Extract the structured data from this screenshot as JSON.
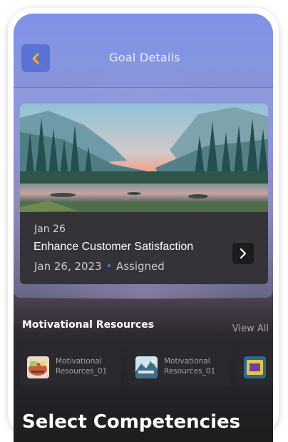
{
  "header": {
    "title": "Goal Details"
  },
  "goal": {
    "date_short": "Jan 26",
    "title": "Enhance Customer Satisfaction",
    "date_full": "Jan 26, 2023",
    "status": "Assigned"
  },
  "resources": {
    "heading": "Motivational Resources",
    "view_all": "View All",
    "items": [
      {
        "line1": "Motivational",
        "line2": "Resources_01"
      },
      {
        "line1": "Motivational",
        "line2": "Resources_01"
      }
    ]
  },
  "competencies": {
    "heading": "Select Competencies"
  },
  "colors": {
    "accent": "#5b73d6",
    "back_arrow": "#f2b13a",
    "status_dot": "#5a6fe0"
  },
  "icons": {
    "back": "chevron-left-icon",
    "forward": "chevron-right-icon"
  }
}
